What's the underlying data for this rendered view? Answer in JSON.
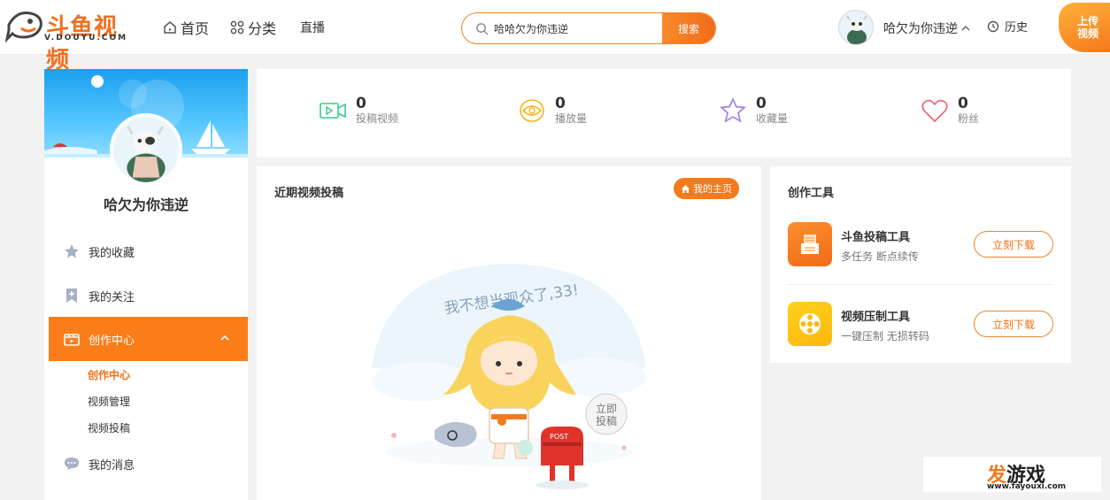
{
  "header": {
    "logo_text": "斗鱼视频",
    "logo_sub": "V.DOUYU.COM",
    "nav": {
      "home_label": "首页",
      "category_label": "分类",
      "live_label": "直播"
    },
    "search": {
      "value": "哈哈欠为你违逆",
      "button_label": "搜索"
    },
    "user_name": "哈欠为你违逆",
    "history_label": "历史",
    "upload_label_line1": "上传",
    "upload_label_line2": "视频"
  },
  "sidebar": {
    "username": "哈欠为你违逆",
    "menu": {
      "favorites": "我的收藏",
      "following": "我的关注",
      "creation_center": "创作中心",
      "messages": "我的消息"
    },
    "submenu": {
      "item1": "创作中心",
      "item2": "视频管理",
      "item3": "视频投稿"
    }
  },
  "stats": {
    "videos": {
      "value": "0",
      "label": "投稿视频"
    },
    "plays": {
      "value": "0",
      "label": "播放量"
    },
    "favorites": {
      "value": "0",
      "label": "收藏量"
    },
    "fans": {
      "value": "0",
      "label": "粉丝"
    }
  },
  "recent": {
    "title": "近期视频投稿",
    "home_button": "我的主页",
    "illus_caption": "我不想当观众了,33!",
    "illus_bubble_line1": "立即",
    "illus_bubble_line2": "投稿",
    "mailbox_label": "POST"
  },
  "tools": {
    "title": "创作工具",
    "items": [
      {
        "name": "斗鱼投稿工具",
        "desc": "多任务 断点续传",
        "button": "立刻下载"
      },
      {
        "name": "视频压制工具",
        "desc": "一键压制 无损转码",
        "button": "立刻下载"
      }
    ]
  },
  "watermark": {
    "brand_fa": "发",
    "brand_rest": "游戏",
    "url": "www.fayouxi.com"
  },
  "colors": {
    "accent": "#fb7d19",
    "search_border": "#f0842a",
    "tool1": "#f36a17",
    "tool2": "#fbb80e"
  }
}
